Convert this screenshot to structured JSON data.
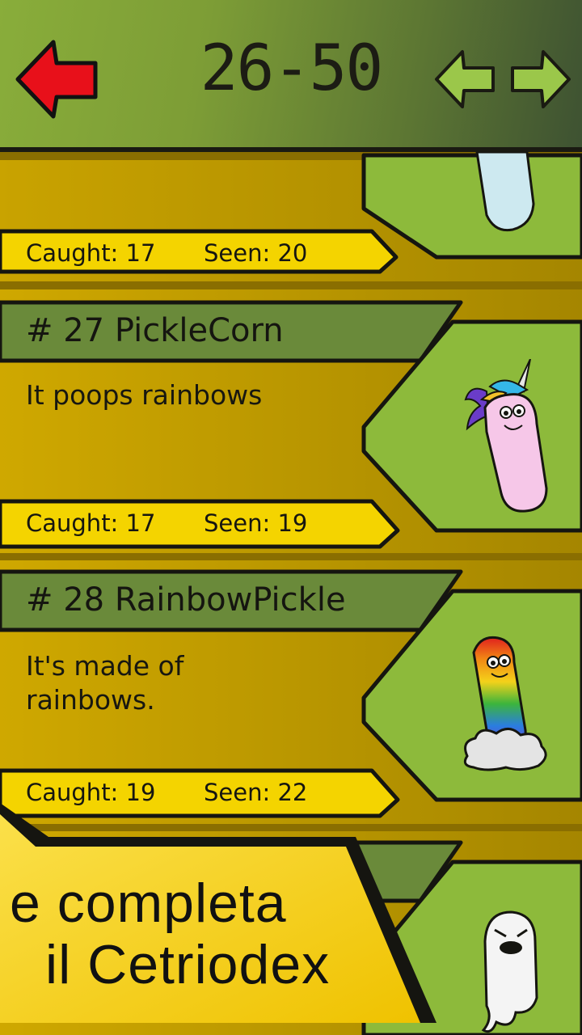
{
  "header": {
    "page_range": "26-50",
    "back_icon": "red-left-arrow-icon",
    "prev_icon": "green-left-arrow-icon",
    "next_icon": "green-right-arrow-icon"
  },
  "entries": [
    {
      "name": "",
      "description": "",
      "caught": "Caught: 17",
      "seen": "Seen: 20",
      "image": "blue-pickle"
    },
    {
      "name": "# 27 PickleCorn",
      "description": "It poops rainbows",
      "caught": "Caught: 17",
      "seen": "Seen: 19",
      "image": "unicorn-pickle"
    },
    {
      "name": "# 28 RainbowPickle",
      "description": "It's made of\nrainbows.",
      "caught": "Caught: 19",
      "seen": "Seen: 22",
      "image": "rainbow-pickle-on-cloud"
    },
    {
      "name": "",
      "description": "",
      "caught": "",
      "seen": "",
      "image": "ghost-pickle"
    }
  ],
  "promo": {
    "line1": "e completa",
    "line2": "il Cetriodex"
  },
  "colors": {
    "card_gold": "#c9a300",
    "banner_green": "#6a8a3a",
    "stat_yellow": "#f4d400",
    "frame_green": "#8dba3b",
    "promo_yellow": "#f5cf00",
    "back_red": "#e8101a",
    "nav_green": "#9bc74a"
  }
}
